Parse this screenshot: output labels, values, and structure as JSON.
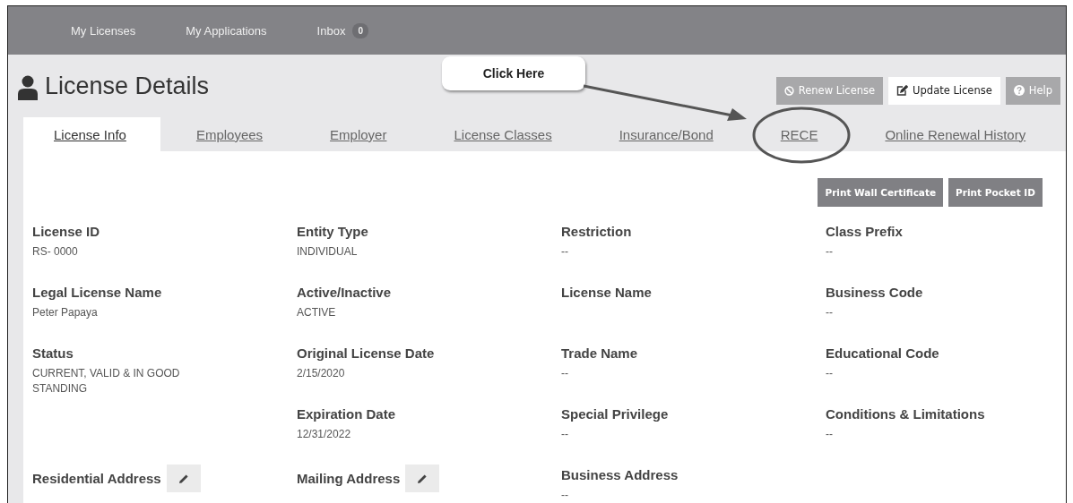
{
  "nav": [
    {
      "label": "My Licenses"
    },
    {
      "label": "My Applications"
    },
    {
      "label": "Inbox",
      "badge": "0"
    }
  ],
  "title": "License Details",
  "callout": {
    "text": "Click Here"
  },
  "header_buttons": [
    {
      "label": "Renew License",
      "kind": "renew"
    },
    {
      "label": "Update License",
      "kind": "update"
    },
    {
      "label": "Help",
      "kind": "help"
    }
  ],
  "tabs": [
    {
      "label": "License Info",
      "selected": true
    },
    {
      "label": "Employees",
      "selected": false
    },
    {
      "label": "Employer",
      "selected": false
    },
    {
      "label": "License Classes",
      "selected": false
    },
    {
      "label": "Insurance/Bond",
      "selected": false
    },
    {
      "label": "RECE",
      "selected": false
    },
    {
      "label": "Online Renewal History",
      "selected": false
    }
  ],
  "print_buttons": [
    "Print Wall Certificate",
    "Print Pocket ID"
  ],
  "columns": [
    [
      {
        "label": "License ID",
        "value": "RS- 0000"
      },
      {
        "label": "Legal License Name",
        "value": "Peter Papaya"
      },
      {
        "label": "Status",
        "value": "CURRENT, VALID & IN GOOD STANDING"
      },
      {
        "label": "Residential Address",
        "kind": "address",
        "editable": true
      }
    ],
    [
      {
        "label": "Entity Type",
        "value": "INDIVIDUAL"
      },
      {
        "label": "Active/Inactive",
        "value": "ACTIVE"
      },
      {
        "label": "Original License Date",
        "value": "2/15/2020"
      },
      {
        "label": "Expiration Date",
        "value": "12/31/2022"
      },
      {
        "label": "Mailing Address",
        "kind": "address",
        "editable": true
      }
    ],
    [
      {
        "label": "Restriction",
        "value": "--"
      },
      {
        "label": "License Name"
      },
      {
        "label": "Trade Name",
        "value": "--"
      },
      {
        "label": "Special Privilege",
        "value": "--"
      },
      {
        "label": "Business Address",
        "kind": "address",
        "value": "--"
      }
    ],
    [
      {
        "label": "Class Prefix",
        "value": "--"
      },
      {
        "label": "Business Code",
        "value": "--"
      },
      {
        "label": "Educational Code",
        "value": "--"
      },
      {
        "label": "Conditions & Limitations",
        "value": "--"
      }
    ]
  ]
}
